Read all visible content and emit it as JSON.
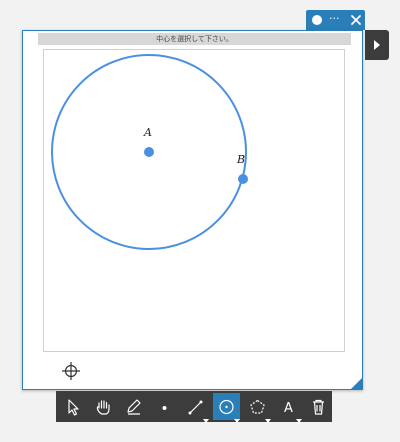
{
  "window": {
    "menu_icon": "more-icon",
    "close_icon": "close-icon",
    "hint": "中心を選択して下さい。"
  },
  "geometry": {
    "center_label": "A",
    "point_label": "B",
    "circle_color": "#4a90e2",
    "accent_color": "#2b7fb8"
  },
  "toolbar": {
    "tools": [
      {
        "name": "select-tool",
        "icon": "cursor-icon"
      },
      {
        "name": "pan-tool",
        "icon": "hand-icon"
      },
      {
        "name": "pen-tool",
        "icon": "pen-icon"
      },
      {
        "name": "point-tool",
        "icon": "point-icon"
      },
      {
        "name": "line-tool",
        "icon": "line-icon"
      },
      {
        "name": "circle-tool",
        "icon": "circle-icon",
        "active": true
      },
      {
        "name": "polygon-tool",
        "icon": "pentagon-icon"
      },
      {
        "name": "text-tool",
        "icon": "text-icon",
        "label": "A"
      },
      {
        "name": "delete-tool",
        "icon": "trash-icon"
      }
    ]
  }
}
